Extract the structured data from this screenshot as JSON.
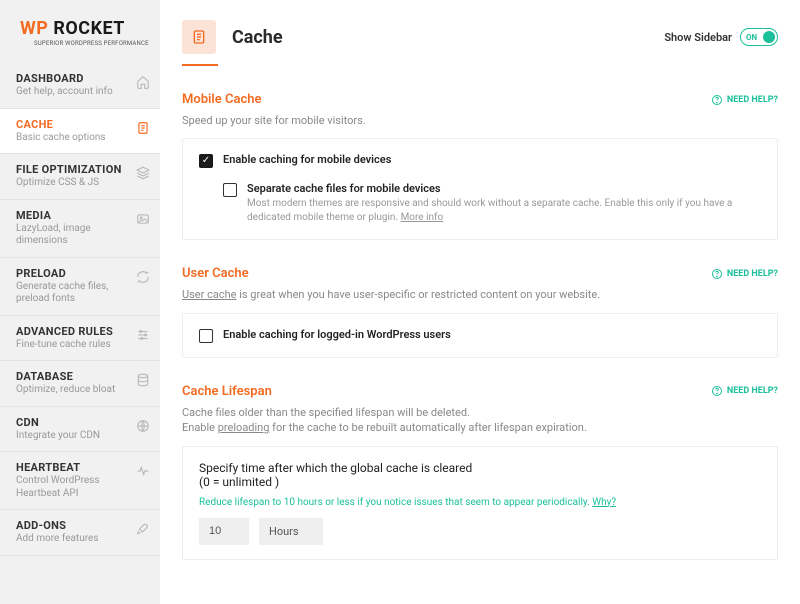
{
  "logo": {
    "wp": "WP",
    "rocket": "ROCKET",
    "tagline": "Superior WordPress Performance"
  },
  "nav": [
    {
      "title": "DASHBOARD",
      "sub": "Get help, account info"
    },
    {
      "title": "CACHE",
      "sub": "Basic cache options"
    },
    {
      "title": "FILE OPTIMIZATION",
      "sub": "Optimize CSS & JS"
    },
    {
      "title": "MEDIA",
      "sub": "LazyLoad, image dimensions"
    },
    {
      "title": "PRELOAD",
      "sub": "Generate cache files, preload fonts"
    },
    {
      "title": "ADVANCED RULES",
      "sub": "Fine-tune cache rules"
    },
    {
      "title": "DATABASE",
      "sub": "Optimize, reduce bloat"
    },
    {
      "title": "CDN",
      "sub": "Integrate your CDN"
    },
    {
      "title": "HEARTBEAT",
      "sub": "Control WordPress Heartbeat API"
    },
    {
      "title": "ADD-ONS",
      "sub": "Add more features"
    }
  ],
  "header": {
    "title": "Cache",
    "show_sidebar": "Show Sidebar",
    "toggle_on": "ON"
  },
  "need_help": "NEED HELP?",
  "mobile": {
    "title": "Mobile Cache",
    "desc": "Speed up your site for mobile visitors.",
    "check1": "Enable caching for mobile devices",
    "check2": "Separate cache files for mobile devices",
    "check2_sub_a": "Most modern themes are responsive and should work without a separate cache. Enable this only if you have a dedicated mobile theme or plugin. ",
    "check2_sub_b": "More info"
  },
  "user": {
    "title": "User Cache",
    "desc_a": "User cache",
    "desc_b": " is great when you have user-specific or restricted content on your website.",
    "check1": "Enable caching for logged-in WordPress users"
  },
  "lifespan": {
    "title": "Cache Lifespan",
    "desc_a": "Cache files older than the specified lifespan will be deleted.",
    "desc_b_pre": "Enable ",
    "desc_b_link": "preloading",
    "desc_b_post": " for the cache to be rebuilt automatically after lifespan expiration.",
    "card_title": "Specify time after which the global cache is cleared\n(0 = unlimited )",
    "card_hint": "Reduce lifespan to 10 hours or less if you notice issues that seem to appear periodically. ",
    "card_hint_link": "Why?",
    "value": "10",
    "unit": "Hours"
  }
}
